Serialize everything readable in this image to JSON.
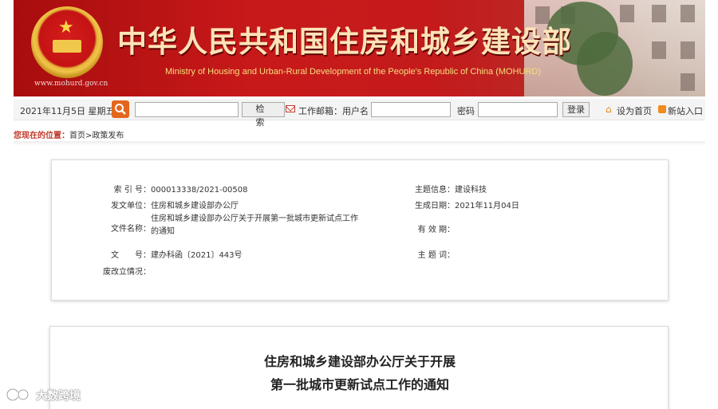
{
  "banner": {
    "url": "www.mohurd.gov.cn",
    "title": "中华人民共和国住房和城乡建设部",
    "subtitle": "Ministry of Housing and Urban-Rural Development of the People's Republic of China (MOHURD)"
  },
  "toolbar": {
    "date": "2021年11月5日 星期五",
    "search_button_label": "检　索",
    "mail_label": "工作邮箱：用户名",
    "password_label": "密码",
    "login_label": "登录",
    "set_home_label": "设为首页",
    "new_entry_label": "新站入口"
  },
  "breadcrumb": {
    "label": "您现在的位置：",
    "path": "首页>政策发布"
  },
  "info": {
    "index_no": {
      "key": "索 引 号：",
      "value": "000013338/2021-00508"
    },
    "topic_info": {
      "key": "主题信息：",
      "value": "建设科技"
    },
    "issuer": {
      "key": "发文单位：",
      "value": "住房和城乡建设部办公厅"
    },
    "generated_date": {
      "key": "生成日期：",
      "value": "2021年11月04日"
    },
    "doc_name": {
      "key": "文件名称：",
      "value": "住房和城乡建设部办公厅关于开展第一批城市更新试点工作的通知"
    },
    "validity": {
      "key": "有 效 期：",
      "value": ""
    },
    "doc_no": {
      "key": "文　　号：",
      "value": "建办科函〔2021〕443号"
    },
    "keywords": {
      "key": "主 题 词：",
      "value": ""
    },
    "revision": {
      "key": "废改立情况：",
      "value": ""
    }
  },
  "article": {
    "title_line1": "住房和城乡建设部办公厅关于开展",
    "title_line2": "第一批城市更新试点工作的通知"
  },
  "watermark": {
    "text": "大数跨境"
  },
  "colors": {
    "banner_red": "#c41a1c",
    "banner_title": "#fde3b8",
    "search_orange": "#e4661c",
    "breadcrumb_label": "#c0392b"
  }
}
